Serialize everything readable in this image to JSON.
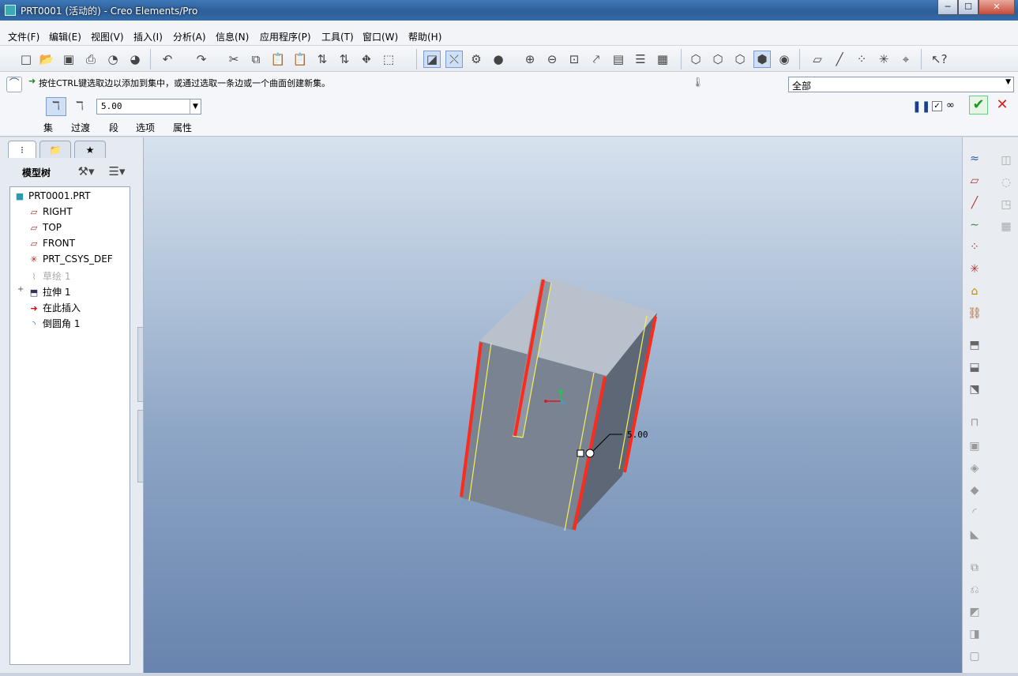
{
  "window": {
    "title": "PRT0001 (活动的) - Creo Elements/Pro",
    "controls": [
      "─",
      "☐",
      "✕"
    ]
  },
  "menubar": [
    "文件(F)",
    "编辑(E)",
    "视图(V)",
    "插入(I)",
    "分析(A)",
    "信息(N)",
    "应用程序(P)",
    "工具(T)",
    "窗口(W)",
    "帮助(H)"
  ],
  "dashboard": {
    "message": "按住CTRL键选取边以添加到集中，或通过选取一条边或一个曲面创建新集。",
    "filter_value": "全部",
    "radius_value": "5.00",
    "tabs": [
      "集",
      "过渡",
      "段",
      "选项",
      "属性"
    ]
  },
  "navigator": {
    "title": "模型树",
    "tree": [
      {
        "label": "PRT0001.PRT",
        "icon": "part-icon",
        "indent": 0
      },
      {
        "label": "RIGHT",
        "icon": "datum-plane-icon",
        "indent": 1
      },
      {
        "label": "TOP",
        "icon": "datum-plane-icon",
        "indent": 1
      },
      {
        "label": "FRONT",
        "icon": "datum-plane-icon",
        "indent": 1
      },
      {
        "label": "PRT_CSYS_DEF",
        "icon": "csys-icon",
        "indent": 1
      },
      {
        "label": "草绘 1",
        "icon": "sketch-icon",
        "indent": 1,
        "dim": true
      },
      {
        "label": "拉伸 1",
        "icon": "extrude-icon",
        "indent": 1,
        "expandable": true
      },
      {
        "label": "在此插入",
        "icon": "insert-arrow-icon",
        "indent": 1
      },
      {
        "label": "倒圆角 1",
        "icon": "round-icon",
        "indent": 1
      }
    ]
  },
  "viewport": {
    "dimension_label": "5.00"
  },
  "colors": {
    "accent_red": "#ff2a1a",
    "edge_yellow": "#f4f05a",
    "model_face": "#7a8392"
  }
}
